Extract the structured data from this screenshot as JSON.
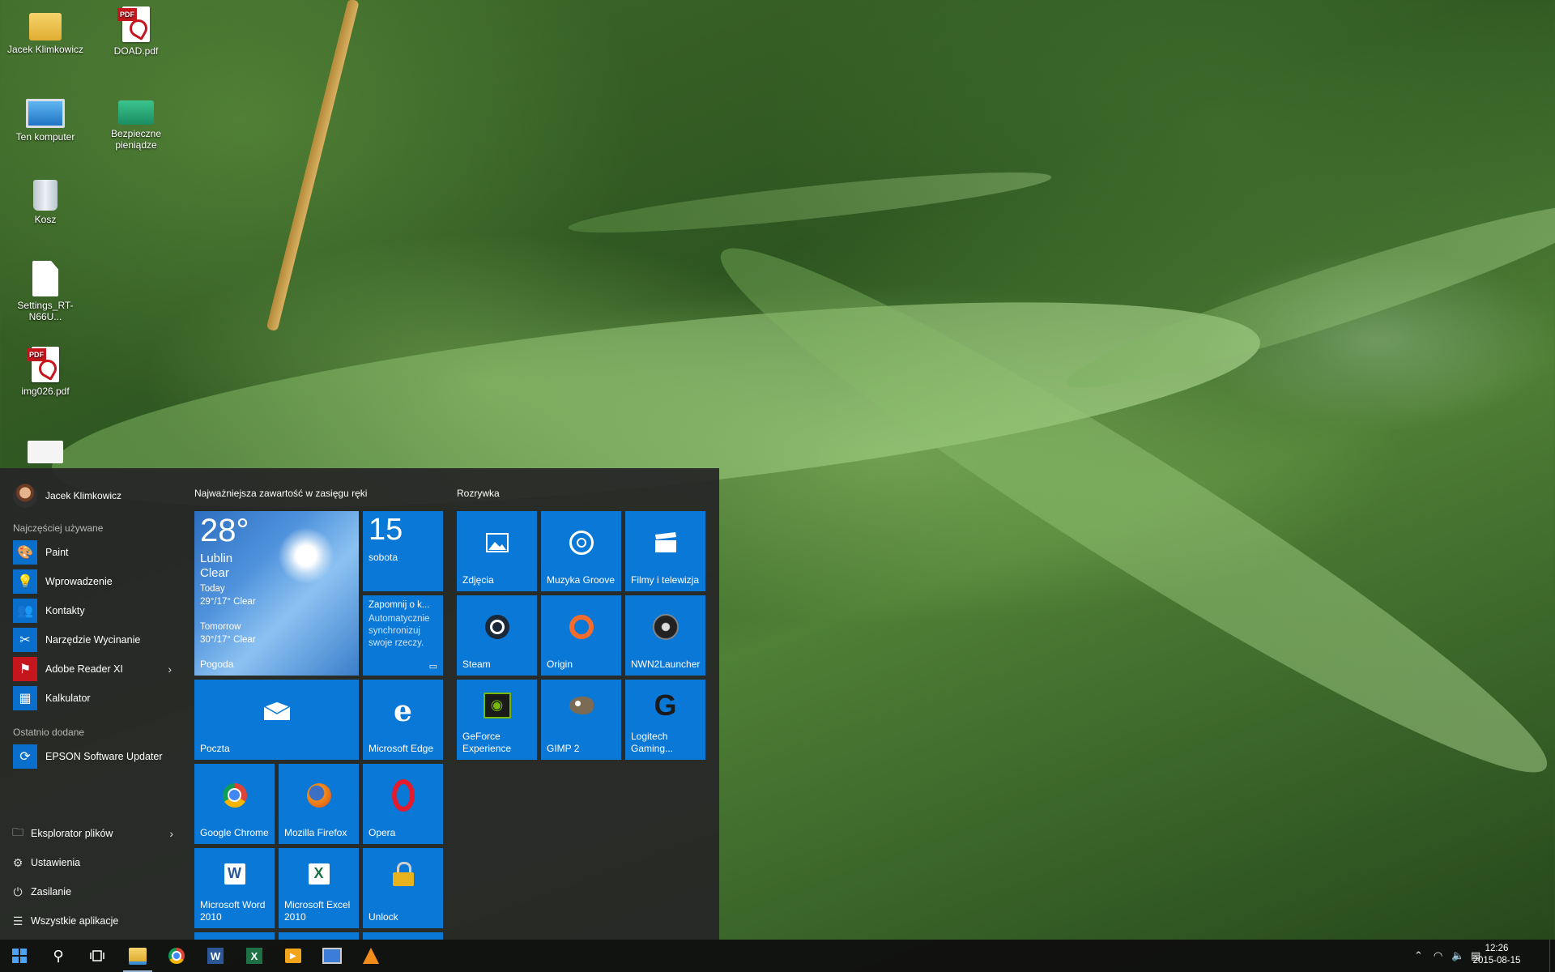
{
  "desktop": {
    "icons": [
      {
        "label": "Jacek Klimkowicz",
        "icon": "user-folder-icon"
      },
      {
        "label": "DOAD.pdf",
        "icon": "pdf-icon"
      },
      {
        "label": "Ten komputer",
        "icon": "computer-icon"
      },
      {
        "label": "Bezpieczne pieniądze",
        "icon": "money-icon"
      },
      {
        "label": "Kosz",
        "icon": "recycle-bin-icon"
      },
      {
        "label": "Settings_RT-N66U...",
        "icon": "document-icon"
      },
      {
        "label": "img026.pdf",
        "icon": "pdf-icon"
      }
    ]
  },
  "start": {
    "user_name": "Jacek Klimkowicz",
    "most_used_label": "Najczęściej używane",
    "most_used": [
      {
        "label": "Paint",
        "icon": "paint-icon"
      },
      {
        "label": "Wprowadzenie",
        "icon": "lightbulb-icon"
      },
      {
        "label": "Kontakty",
        "icon": "people-icon"
      },
      {
        "label": "Narzędzie Wycinanie",
        "icon": "snipping-tool-icon"
      },
      {
        "label": "Adobe Reader XI",
        "icon": "adobe-reader-icon",
        "has_submenu": true
      },
      {
        "label": "Kalkulator",
        "icon": "calculator-icon"
      }
    ],
    "recent_label": "Ostatnio dodane",
    "recent": [
      {
        "label": "EPSON Software Updater",
        "icon": "epson-icon"
      }
    ],
    "system": [
      {
        "label": "Eksplorator plików",
        "icon": "file-explorer-icon",
        "has_submenu": true
      },
      {
        "label": "Ustawienia",
        "icon": "gear-icon"
      },
      {
        "label": "Zasilanie",
        "icon": "power-icon"
      },
      {
        "label": "Wszystkie aplikacje",
        "icon": "all-apps-icon"
      }
    ],
    "group1_title": "Najważniejsza zawartość w zasięgu ręki",
    "group2_title": "Rozrywka",
    "weather": {
      "temp": "28°",
      "city": "Lublin",
      "condition": "Clear",
      "today_label": "Today",
      "today": "29°/17° Clear",
      "tomorrow_label": "Tomorrow",
      "tomorrow": "30°/17° Clear",
      "app": "Pogoda"
    },
    "calendar": {
      "day": "15",
      "weekday": "sobota"
    },
    "onenote": {
      "title": "Zapomnij o k...",
      "body": "Automatycznie synchronizuj swoje rzeczy."
    },
    "tiles": {
      "mail": "Poczta",
      "edge": "Microsoft Edge",
      "chrome": "Google Chrome",
      "firefox": "Mozilla Firefox",
      "opera": "Opera",
      "word": "Microsoft Word 2010",
      "excel": "Microsoft Excel 2010",
      "unlock": "Unlock",
      "photos": "Zdjęcia",
      "groove": "Muzyka Groove",
      "movies": "Filmy i telewizja",
      "steam": "Steam",
      "origin": "Origin",
      "nwn2": "NWN2Launcher",
      "geforce": "GeForce Experience",
      "gimp": "GIMP 2",
      "logitech": "Logitech Gaming..."
    }
  },
  "taskbar": {
    "pinned": [
      "file-explorer-icon",
      "chrome-icon",
      "word-icon",
      "excel-icon",
      "media-player-icon",
      "remote-desktop-icon",
      "vlc-icon"
    ],
    "time": "12:26",
    "date": "2015-08-15"
  },
  "colors": {
    "tile_blue": "#0a78d7",
    "start_bg": "#262626",
    "taskbar_bg": "#101010"
  }
}
